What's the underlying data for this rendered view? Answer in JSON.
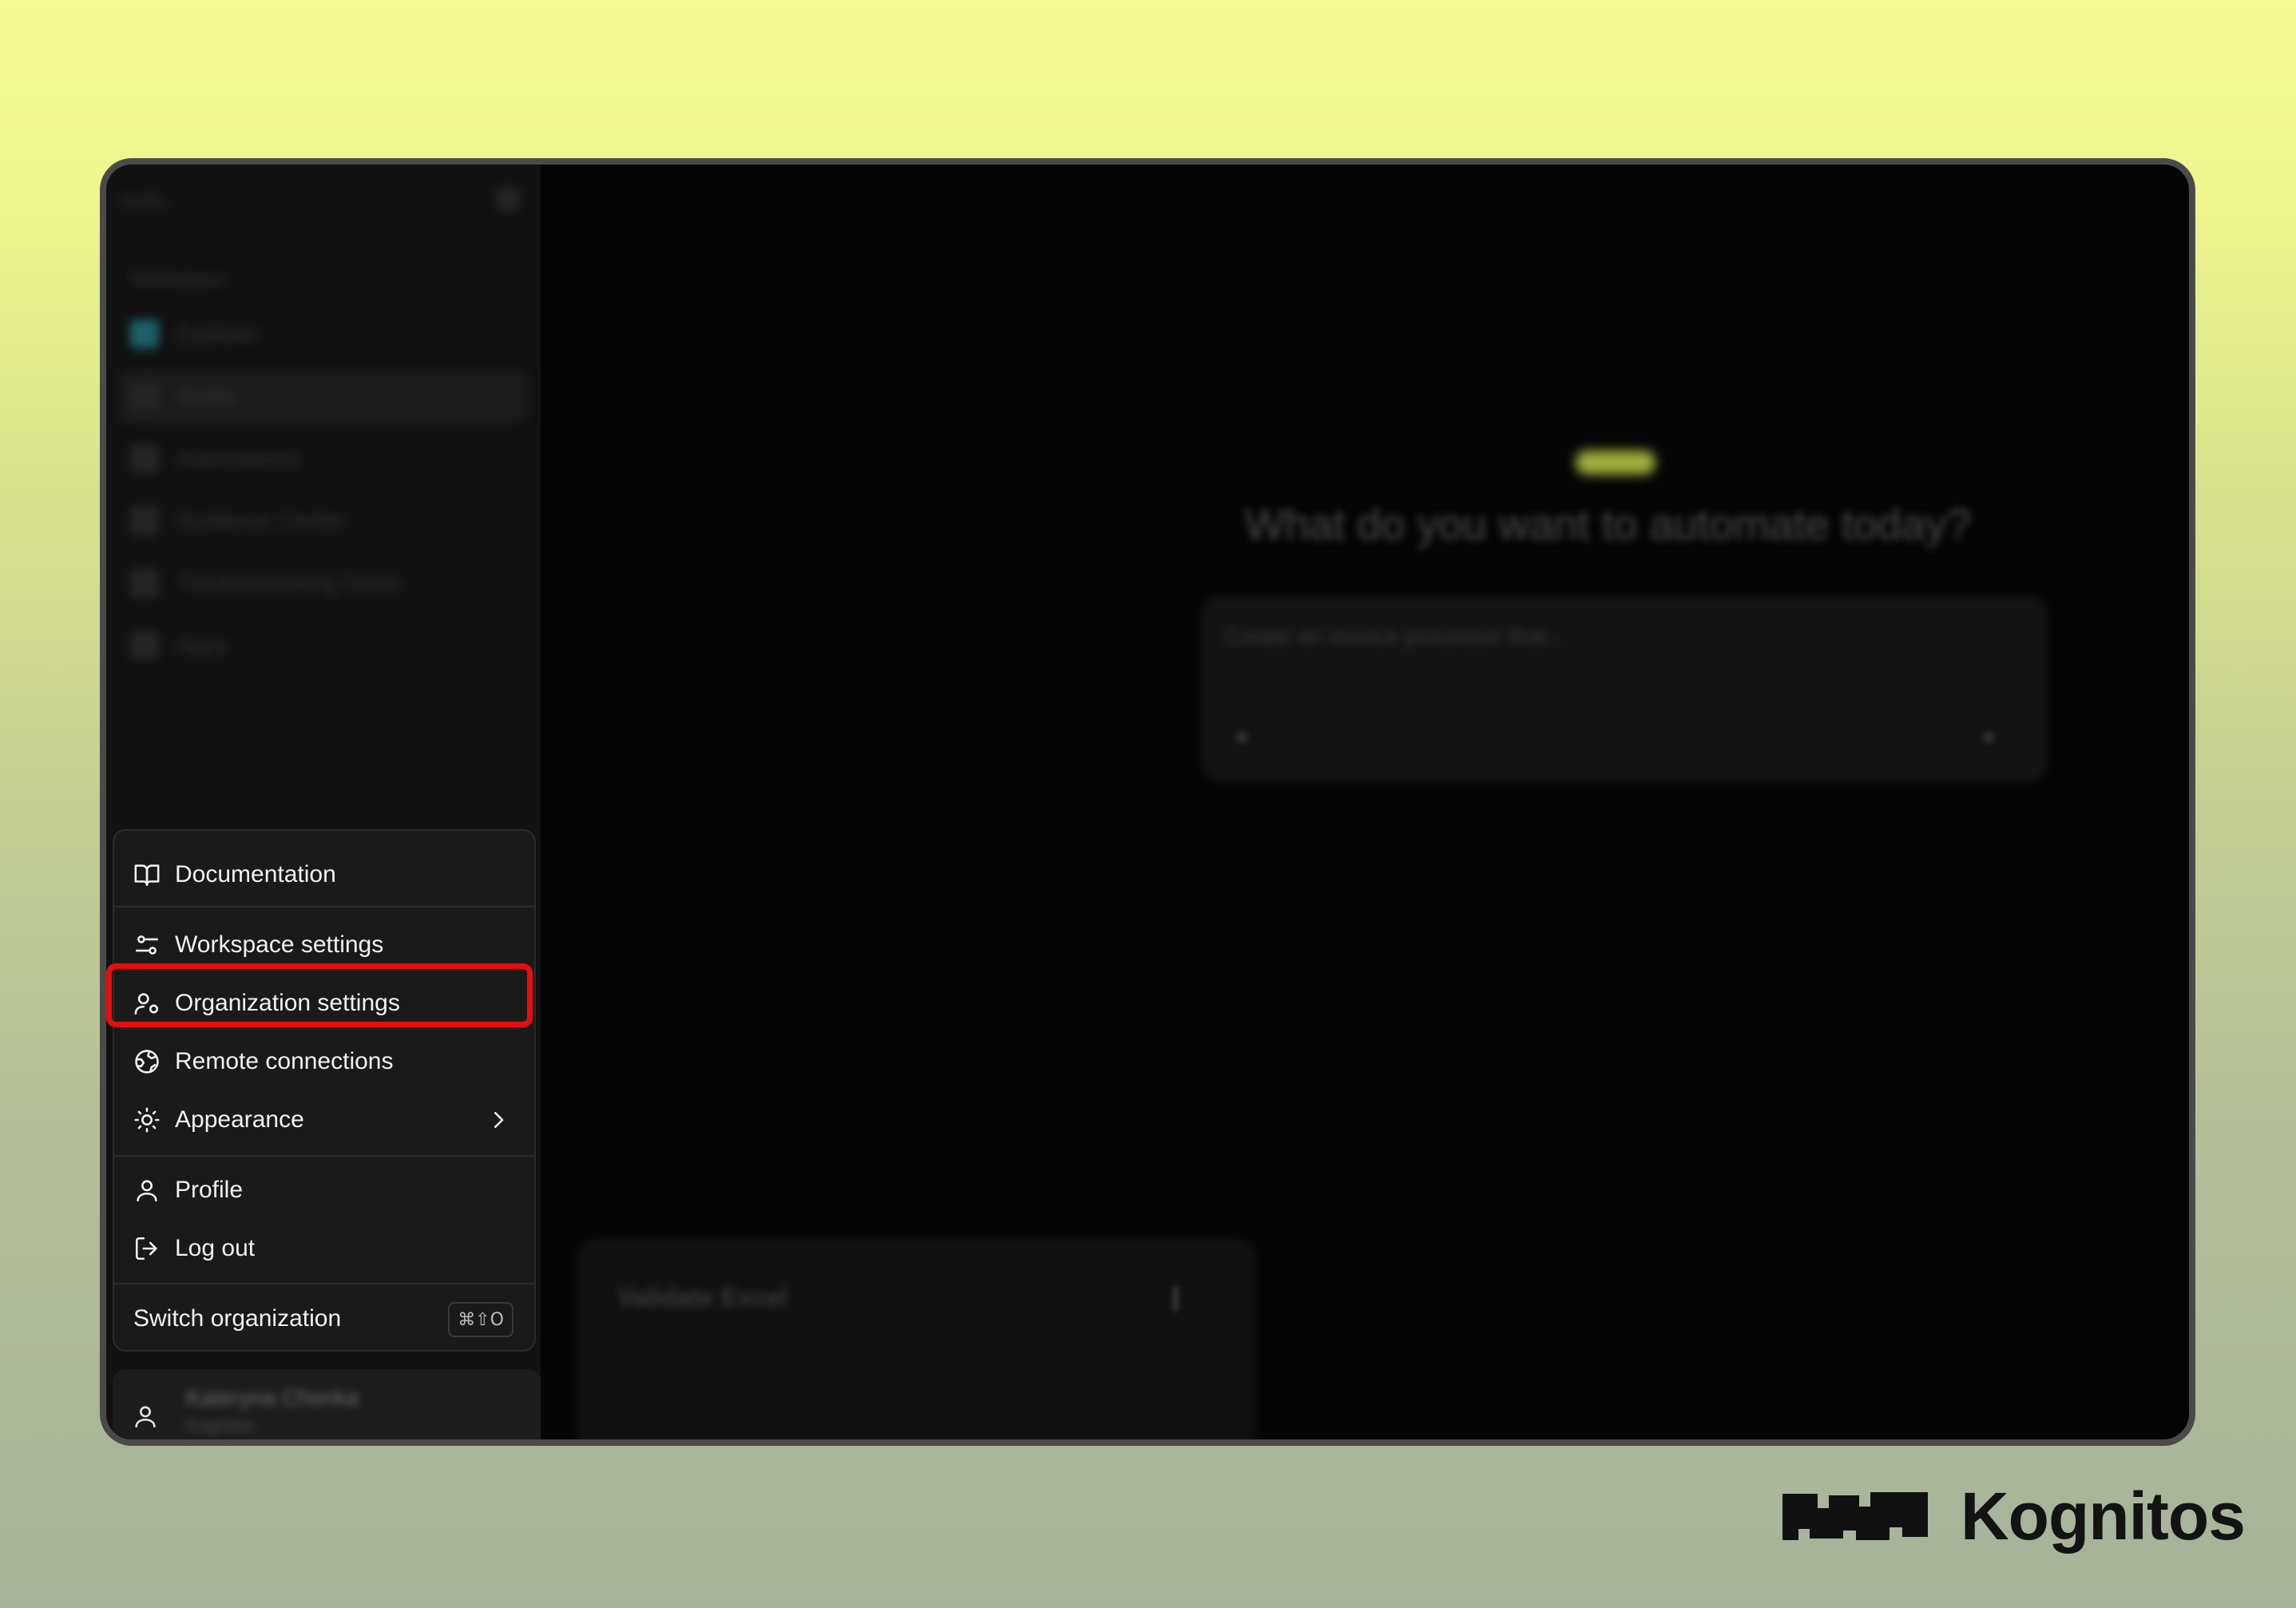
{
  "window": {
    "sidebar": {
      "brand": "Kello",
      "section_label": "Workspace",
      "items": [
        {
          "label": "Explorer"
        },
        {
          "label": "Drafts"
        },
        {
          "label": "Automations"
        },
        {
          "label": "Guidance Center"
        },
        {
          "label": "Troubleshooting Guide"
        },
        {
          "label": "Apps"
        }
      ]
    },
    "main": {
      "heading": "What do you want to automate today?",
      "input_placeholder": "Create an invoice processor that...",
      "card_title": "Validate Excel"
    },
    "user": {
      "name": "Kateryna Chonka",
      "org": "Kognitos"
    }
  },
  "menu": {
    "documentation": "Documentation",
    "workspace_settings": "Workspace settings",
    "organization_settings": "Organization settings",
    "remote_connections": "Remote connections",
    "appearance": "Appearance",
    "profile": "Profile",
    "log_out": "Log out",
    "switch_organization": "Switch organization",
    "switch_shortcut": "⌘⇧O"
  },
  "icons": {
    "documentation": "book-open-icon",
    "workspace_settings": "sliders-icon",
    "organization_settings": "user-gear-icon",
    "remote_connections": "globe-icon",
    "appearance": "sun-icon",
    "profile": "user-icon",
    "log_out": "log-out-icon",
    "chevron": "chevron-right-icon"
  },
  "colors": {
    "highlight": "#e70d0d",
    "menu_bg": "#1a1a1a",
    "app_bg": "#050505"
  },
  "brand": {
    "logo_text": "Kognitos"
  }
}
